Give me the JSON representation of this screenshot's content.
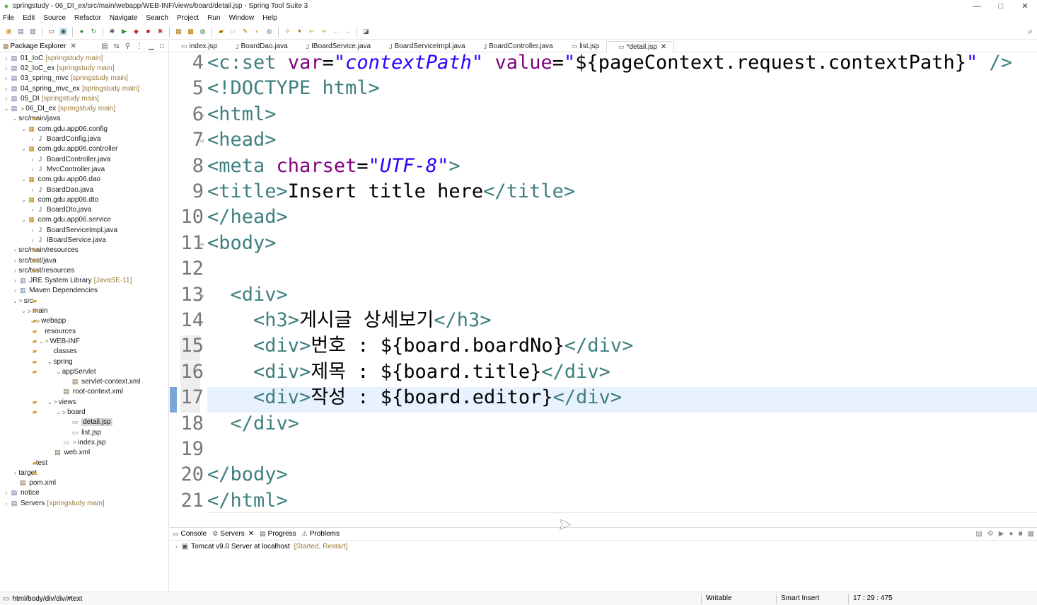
{
  "window": {
    "title": "springstudy - 06_DI_ex/src/main/webapp/WEB-INF/views/board/detail.jsp - Spring Tool Suite 3",
    "minimize": "—",
    "maximize": "□",
    "close": "✕"
  },
  "menu": [
    "File",
    "Edit",
    "Source",
    "Refactor",
    "Navigate",
    "Search",
    "Project",
    "Run",
    "Window",
    "Help"
  ],
  "package_explorer": {
    "title": "Package Explorer",
    "close": "✕"
  },
  "tree": [
    {
      "indent": 0,
      "tw": "›",
      "icon": "proj",
      "dec": "",
      "label": "01_IoC",
      "extra": "[springstudy main]"
    },
    {
      "indent": 0,
      "tw": "›",
      "icon": "proj",
      "dec": "",
      "label": "02_IoC_ex",
      "extra": "[springstudy main]"
    },
    {
      "indent": 0,
      "tw": "›",
      "icon": "proj",
      "dec": "",
      "label": "03_spring_mvc",
      "extra": "[springstudy main]"
    },
    {
      "indent": 0,
      "tw": "›",
      "icon": "proj",
      "dec": "",
      "label": "04_spring_mvc_ex",
      "extra": "[springstudy main]"
    },
    {
      "indent": 0,
      "tw": "›",
      "icon": "proj",
      "dec": "",
      "label": "05_DI",
      "extra": "[springstudy main]"
    },
    {
      "indent": 0,
      "tw": "⌄",
      "icon": "proj",
      "dec": ">",
      "label": "06_DI_ex",
      "extra": "[springstudy main]"
    },
    {
      "indent": 1,
      "tw": "⌄",
      "icon": "fold",
      "dec": "",
      "label": "src/main/java",
      "extra": ""
    },
    {
      "indent": 2,
      "tw": "⌄",
      "icon": "pkg",
      "dec": "",
      "label": "com.gdu.app06.config",
      "extra": ""
    },
    {
      "indent": 3,
      "tw": "›",
      "icon": "java",
      "dec": "",
      "label": "BoardConfig.java",
      "extra": ""
    },
    {
      "indent": 2,
      "tw": "⌄",
      "icon": "pkg",
      "dec": "",
      "label": "com.gdu.app06.controller",
      "extra": ""
    },
    {
      "indent": 3,
      "tw": "›",
      "icon": "java",
      "dec": "",
      "label": "BoardController.java",
      "extra": ""
    },
    {
      "indent": 3,
      "tw": "›",
      "icon": "java",
      "dec": "",
      "label": "MvcController.java",
      "extra": ""
    },
    {
      "indent": 2,
      "tw": "⌄",
      "icon": "pkg",
      "dec": "",
      "label": "com.gdu.app06.dao",
      "extra": ""
    },
    {
      "indent": 3,
      "tw": "›",
      "icon": "java",
      "dec": "",
      "label": "BoardDao.java",
      "extra": ""
    },
    {
      "indent": 2,
      "tw": "⌄",
      "icon": "pkg",
      "dec": "",
      "label": "com.gdu.app06.dto",
      "extra": ""
    },
    {
      "indent": 3,
      "tw": "›",
      "icon": "java",
      "dec": "",
      "label": "BoardDto.java",
      "extra": ""
    },
    {
      "indent": 2,
      "tw": "⌄",
      "icon": "pkg",
      "dec": "",
      "label": "com.gdu.app06.service",
      "extra": ""
    },
    {
      "indent": 3,
      "tw": "›",
      "icon": "java",
      "dec": "",
      "label": "BoardServiceImpl.java",
      "extra": ""
    },
    {
      "indent": 3,
      "tw": "›",
      "icon": "java",
      "dec": "",
      "label": "IBoardService.java",
      "extra": ""
    },
    {
      "indent": 1,
      "tw": "›",
      "icon": "fold",
      "dec": "",
      "label": "src/main/resources",
      "extra": ""
    },
    {
      "indent": 1,
      "tw": "›",
      "icon": "fold",
      "dec": "",
      "label": "src/test/java",
      "extra": ""
    },
    {
      "indent": 1,
      "tw": "›",
      "icon": "fold",
      "dec": "",
      "label": "src/test/resources",
      "extra": ""
    },
    {
      "indent": 1,
      "tw": "›",
      "icon": "lib",
      "dec": "",
      "label": "JRE System Library",
      "extra": "[JavaSE-11]"
    },
    {
      "indent": 1,
      "tw": "›",
      "icon": "lib",
      "dec": "",
      "label": "Maven Dependencies",
      "extra": ""
    },
    {
      "indent": 1,
      "tw": "⌄",
      "icon": "fold",
      "dec": ">",
      "label": "src",
      "extra": ""
    },
    {
      "indent": 2,
      "tw": "⌄",
      "icon": "fold",
      "dec": ">",
      "label": "main",
      "extra": ""
    },
    {
      "indent": 3,
      "tw": "⌄",
      "icon": "fold",
      "dec": ">",
      "label": "webapp",
      "extra": ""
    },
    {
      "indent": 4,
      "tw": "",
      "icon": "fold",
      "dec": "",
      "label": "resources",
      "extra": ""
    },
    {
      "indent": 4,
      "tw": "⌄",
      "icon": "fold",
      "dec": ">",
      "label": "WEB-INF",
      "extra": ""
    },
    {
      "indent": 5,
      "tw": "",
      "icon": "fold",
      "dec": "",
      "label": "classes",
      "extra": ""
    },
    {
      "indent": 5,
      "tw": "⌄",
      "icon": "fold",
      "dec": "",
      "label": "spring",
      "extra": ""
    },
    {
      "indent": 6,
      "tw": "⌄",
      "icon": "fold",
      "dec": "",
      "label": "appServlet",
      "extra": ""
    },
    {
      "indent": 7,
      "tw": "",
      "icon": "xml",
      "dec": "",
      "label": "servlet-context.xml",
      "extra": ""
    },
    {
      "indent": 6,
      "tw": "",
      "icon": "xml",
      "dec": "",
      "label": "root-context.xml",
      "extra": ""
    },
    {
      "indent": 5,
      "tw": "⌄",
      "icon": "fold",
      "dec": ">",
      "label": "views",
      "extra": ""
    },
    {
      "indent": 6,
      "tw": "⌄",
      "icon": "fold",
      "dec": ">",
      "label": "board",
      "extra": ""
    },
    {
      "indent": 7,
      "tw": "",
      "icon": "jsp",
      "dec": "",
      "label": "detail.jsp",
      "extra": "",
      "selected": true
    },
    {
      "indent": 7,
      "tw": "",
      "icon": "jsp",
      "dec": "",
      "label": "list.jsp",
      "extra": ""
    },
    {
      "indent": 6,
      "tw": "",
      "icon": "jsp",
      "dec": ">",
      "label": "index.jsp",
      "extra": ""
    },
    {
      "indent": 5,
      "tw": "",
      "icon": "xml",
      "dec": "",
      "label": "web.xml",
      "extra": ""
    },
    {
      "indent": 3,
      "tw": "",
      "icon": "fold",
      "dec": "",
      "label": "test",
      "extra": ""
    },
    {
      "indent": 1,
      "tw": "›",
      "icon": "fold",
      "dec": "",
      "label": "target",
      "extra": ""
    },
    {
      "indent": 1,
      "tw": "",
      "icon": "xml",
      "dec": "",
      "label": "pom.xml",
      "extra": ""
    },
    {
      "indent": 0,
      "tw": "›",
      "icon": "proj",
      "dec": "",
      "label": "notice",
      "extra": ""
    },
    {
      "indent": 0,
      "tw": "›",
      "icon": "proj",
      "dec": "",
      "label": "Servers",
      "extra": "[springstudy main]"
    }
  ],
  "editor_tabs": [
    {
      "label": "index.jsp",
      "active": false
    },
    {
      "label": "BoardDao.java",
      "active": false
    },
    {
      "label": "IBoardService.java",
      "active": false
    },
    {
      "label": "BoardServiceImpl.java",
      "active": false
    },
    {
      "label": "BoardController.java",
      "active": false
    },
    {
      "label": "list.jsp",
      "active": false
    },
    {
      "label": "*detail.jsp",
      "active": true
    }
  ],
  "code_lines": [
    {
      "n": "4",
      "fold": false,
      "parts": [
        [
          "tag",
          "<"
        ],
        [
          "tn",
          "c:set "
        ],
        [
          "at",
          "var"
        ],
        [
          "txt",
          "="
        ],
        [
          "str",
          "\"contextPath\""
        ],
        [
          "txt",
          " "
        ],
        [
          "at",
          "value"
        ],
        [
          "txt",
          "="
        ],
        [
          "str",
          "\""
        ],
        [
          "txt",
          "${pageContext.request.contextPath}"
        ],
        [
          "str",
          "\""
        ],
        [
          "txt",
          " "
        ],
        [
          "tag",
          "/>"
        ]
      ]
    },
    {
      "n": "5",
      "fold": false,
      "parts": [
        [
          "tag",
          "<!DOCTYPE html>"
        ]
      ]
    },
    {
      "n": "6",
      "fold": true,
      "parts": [
        [
          "tag",
          "<html>"
        ]
      ]
    },
    {
      "n": "7",
      "fold": true,
      "parts": [
        [
          "tag",
          "<head>"
        ]
      ]
    },
    {
      "n": "8",
      "fold": false,
      "parts": [
        [
          "tag",
          "<meta "
        ],
        [
          "at",
          "charset"
        ],
        [
          "txt",
          "="
        ],
        [
          "str",
          "\"UTF-8\""
        ],
        [
          "tag",
          ">"
        ]
      ]
    },
    {
      "n": "9",
      "fold": false,
      "parts": [
        [
          "tag",
          "<title>"
        ],
        [
          "txt",
          "Insert title here"
        ],
        [
          "tag",
          "</title>"
        ]
      ]
    },
    {
      "n": "10",
      "fold": false,
      "parts": [
        [
          "tag",
          "</head>"
        ]
      ]
    },
    {
      "n": "11",
      "fold": true,
      "parts": [
        [
          "tag",
          "<body>"
        ]
      ]
    },
    {
      "n": "12",
      "fold": false,
      "parts": []
    },
    {
      "n": "13",
      "fold": true,
      "parts": [
        [
          "txt",
          "  "
        ],
        [
          "tag",
          "<div>"
        ]
      ]
    },
    {
      "n": "14",
      "fold": false,
      "parts": [
        [
          "txt",
          "    "
        ],
        [
          "tag",
          "<h3>"
        ],
        [
          "txt",
          "게시글 상세보기"
        ],
        [
          "tag",
          "</h3>"
        ]
      ]
    },
    {
      "n": "15",
      "fold": false,
      "parts": [
        [
          "txt",
          "    "
        ],
        [
          "tag",
          "<div>"
        ],
        [
          "txt",
          "번호 : ${board.boardNo}"
        ],
        [
          "tag",
          "</div>"
        ]
      ]
    },
    {
      "n": "16",
      "fold": false,
      "parts": [
        [
          "txt",
          "    "
        ],
        [
          "tag",
          "<div>"
        ],
        [
          "txt",
          "제목 : ${board.title}"
        ],
        [
          "tag",
          "</div>"
        ]
      ]
    },
    {
      "n": "17",
      "fold": false,
      "parts": [
        [
          "txt",
          "    "
        ],
        [
          "tag",
          "<div>"
        ],
        [
          "txt",
          "작성 : ${board.editor}"
        ],
        [
          "tag",
          "</div>"
        ]
      ]
    },
    {
      "n": "18",
      "fold": false,
      "parts": [
        [
          "txt",
          "  "
        ],
        [
          "tag",
          "</div>"
        ]
      ]
    },
    {
      "n": "19",
      "fold": false,
      "parts": []
    },
    {
      "n": "20",
      "fold": false,
      "parts": [
        [
          "tag",
          "</body>"
        ]
      ]
    },
    {
      "n": "21",
      "fold": false,
      "parts": [
        [
          "tag",
          "</html>"
        ]
      ]
    }
  ],
  "bottom_tabs": [
    {
      "label": "Console",
      "close": false
    },
    {
      "label": "Servers",
      "close": true
    },
    {
      "label": "Progress",
      "close": false
    },
    {
      "label": "Problems",
      "close": false
    }
  ],
  "server_row": {
    "label": "Tomcat v9.0 Server at localhost",
    "state": "[Started, Restart]"
  },
  "status": {
    "path": "html/body/div/div/#text",
    "writable": "Writable",
    "insert": "Smart Insert",
    "position": "17 : 29 : 475"
  },
  "colors": {
    "tag": "#3f7f7f",
    "attr": "#7f007f",
    "string": "#2a00ff",
    "current_line": "#e8f2fe"
  }
}
